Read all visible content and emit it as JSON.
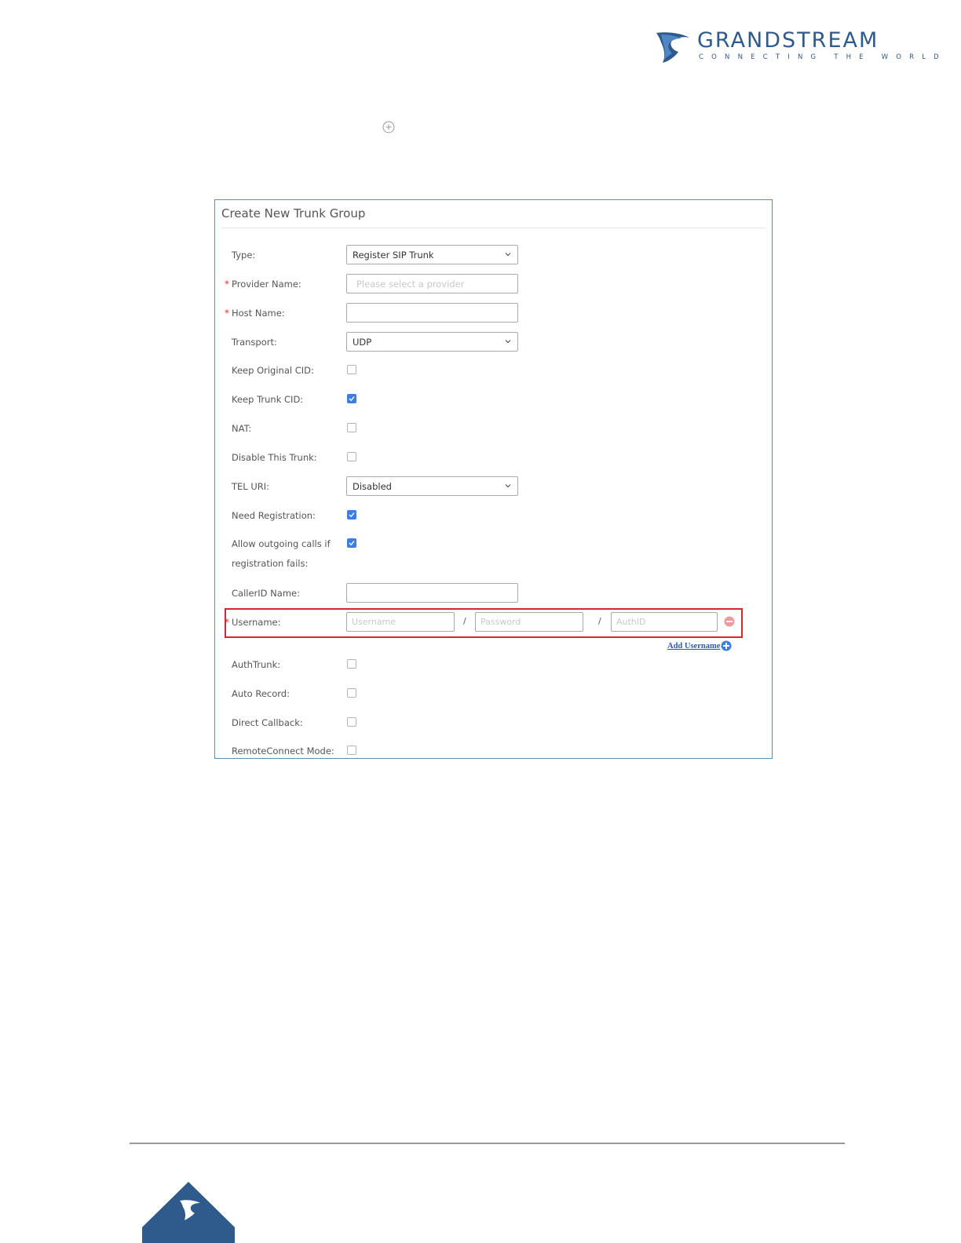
{
  "brand": {
    "name": "GRANDSTREAM",
    "tagline": "CONNECTING THE WORLD",
    "primary_color": "#2f5a8c"
  },
  "panel": {
    "title": "Create New Trunk Group",
    "fields": {
      "type": {
        "label": "Type:",
        "value": "Register SIP Trunk"
      },
      "provider_name": {
        "label": "Provider Name:",
        "placeholder": "Please select a provider",
        "required": true
      },
      "host_name": {
        "label": "Host Name:",
        "value": "",
        "required": true
      },
      "transport": {
        "label": "Transport:",
        "value": "UDP"
      },
      "keep_original_cid": {
        "label": "Keep Original CID:",
        "checked": false
      },
      "keep_trunk_cid": {
        "label": "Keep Trunk CID:",
        "checked": true
      },
      "nat": {
        "label": "NAT:",
        "checked": false
      },
      "disable_trunk": {
        "label": "Disable This Trunk:",
        "checked": false
      },
      "tel_uri": {
        "label": "TEL URI:",
        "value": "Disabled"
      },
      "need_registration": {
        "label": "Need Registration:",
        "checked": true
      },
      "allow_outgoing": {
        "label_line1": "Allow outgoing calls if",
        "label_line2": "registration fails:",
        "checked": true
      },
      "callerid_name": {
        "label": "CallerID Name:",
        "value": ""
      },
      "username": {
        "label": "Username:",
        "required": true,
        "username_placeholder": "Username",
        "password_placeholder": "Password",
        "authid_placeholder": "AuthID",
        "separator": "/"
      },
      "add_username": "Add Username",
      "auth_trunk": {
        "label": "AuthTrunk:",
        "checked": false
      },
      "auto_record": {
        "label": "Auto Record:",
        "checked": false
      },
      "direct_callback": {
        "label": "Direct Callback:",
        "checked": false
      },
      "remote_connect": {
        "label": "RemoteConnect Mode:",
        "checked": false
      }
    },
    "required_marker": "*",
    "highlight_color": "#d9262e",
    "accent_color": "#3b7fe0"
  }
}
